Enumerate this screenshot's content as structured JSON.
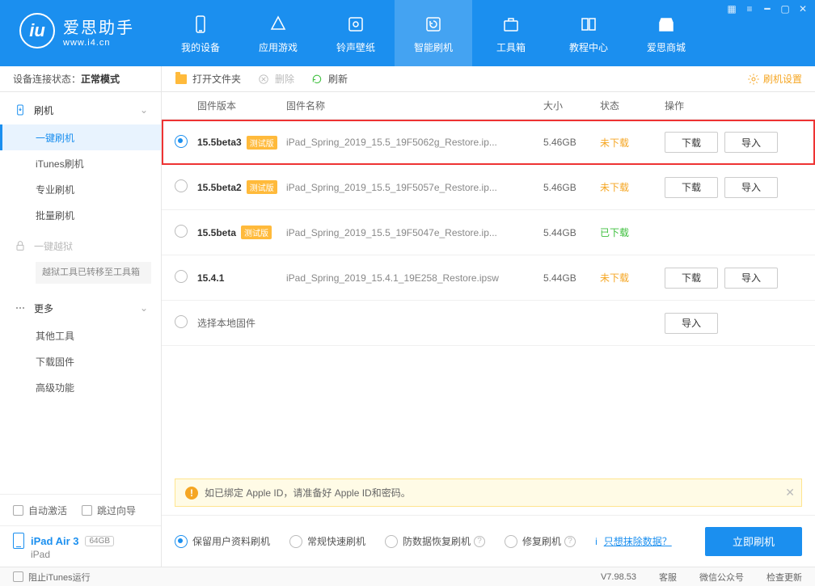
{
  "brand": {
    "name": "爱思助手",
    "url": "www.i4.cn"
  },
  "topnav": {
    "items": [
      "我的设备",
      "应用游戏",
      "铃声壁纸",
      "智能刷机",
      "工具箱",
      "教程中心",
      "爱思商城"
    ]
  },
  "connect_status": {
    "label": "设备连接状态：",
    "mode": "正常模式"
  },
  "sidebar": {
    "flash_header": "刷机",
    "flash_items": [
      "一键刷机",
      "iTunes刷机",
      "专业刷机",
      "批量刷机"
    ],
    "jailbreak_header": "一键越狱",
    "jailbreak_note": "越狱工具已转移至工具箱",
    "more_header": "更多",
    "more_items": [
      "其他工具",
      "下载固件",
      "高级功能"
    ]
  },
  "bottom_left": {
    "auto_activate": "自动激活",
    "skip_guide": "跳过向导"
  },
  "device": {
    "name": "iPad Air 3",
    "capacity": "64GB",
    "type": "iPad"
  },
  "toolbar": {
    "open_folder": "打开文件夹",
    "delete": "删除",
    "refresh": "刷新",
    "settings": "刷机设置"
  },
  "columns": {
    "version": "固件版本",
    "name": "固件名称",
    "size": "大小",
    "status": "状态",
    "action": "操作"
  },
  "badges": {
    "beta": "测试版"
  },
  "buttons": {
    "download": "下载",
    "import": "导入"
  },
  "status_text": {
    "not_downloaded": "未下载",
    "downloaded": "已下载"
  },
  "firmwares": [
    {
      "version": "15.5beta3",
      "beta": true,
      "name": "iPad_Spring_2019_15.5_19F5062g_Restore.ip...",
      "size": "5.46GB",
      "status": "not_downloaded",
      "selected": true,
      "show_download": true
    },
    {
      "version": "15.5beta2",
      "beta": true,
      "name": "iPad_Spring_2019_15.5_19F5057e_Restore.ip...",
      "size": "5.46GB",
      "status": "not_downloaded",
      "selected": false,
      "show_download": true
    },
    {
      "version": "15.5beta",
      "beta": true,
      "name": "iPad_Spring_2019_15.5_19F5047e_Restore.ip...",
      "size": "5.44GB",
      "status": "downloaded",
      "selected": false,
      "show_download": false
    },
    {
      "version": "15.4.1",
      "beta": false,
      "name": "iPad_Spring_2019_15.4.1_19E258_Restore.ipsw",
      "size": "5.44GB",
      "status": "not_downloaded",
      "selected": false,
      "show_download": true
    }
  ],
  "local_row": "选择本地固件",
  "notice": "如已绑定 Apple ID，请准备好 Apple ID和密码。",
  "options": {
    "o1": "保留用户资料刷机",
    "o2": "常规快速刷机",
    "o3": "防数据恢复刷机",
    "o4": "修复刷机",
    "link": "只想抹除数据？",
    "flash_now": "立即刷机"
  },
  "statusbar": {
    "block_itunes": "阻止iTunes运行",
    "version": "V7.98.53",
    "support": "客服",
    "wechat": "微信公众号",
    "update": "检查更新"
  }
}
